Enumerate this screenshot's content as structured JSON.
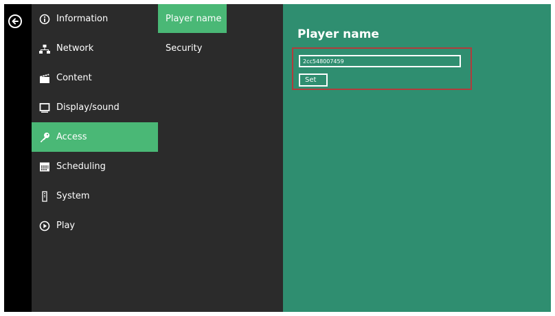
{
  "nav": {
    "back_icon": "arrow-left-circle-icon",
    "items": [
      {
        "label": "Information",
        "icon": "info-icon"
      },
      {
        "label": "Network",
        "icon": "network-icon"
      },
      {
        "label": "Content",
        "icon": "clapperboard-icon"
      },
      {
        "label": "Display/sound",
        "icon": "monitor-icon"
      },
      {
        "label": "Access",
        "icon": "key-icon",
        "active": true
      },
      {
        "label": "Scheduling",
        "icon": "calendar-icon"
      },
      {
        "label": "System",
        "icon": "system-icon"
      },
      {
        "label": "Play",
        "icon": "play-icon"
      }
    ]
  },
  "subnav": {
    "items": [
      {
        "label": "Player name",
        "active": true
      },
      {
        "label": "Security"
      }
    ]
  },
  "content": {
    "title": "Player name",
    "input_value": "2cc548007459",
    "set_label": "Set"
  },
  "colors": {
    "backbar": "#000000",
    "sidebar": "#2b2b2b",
    "active": "#4ab876",
    "content": "#2f8e70",
    "highlight": "#b23b3b",
    "text": "#ffffff"
  }
}
